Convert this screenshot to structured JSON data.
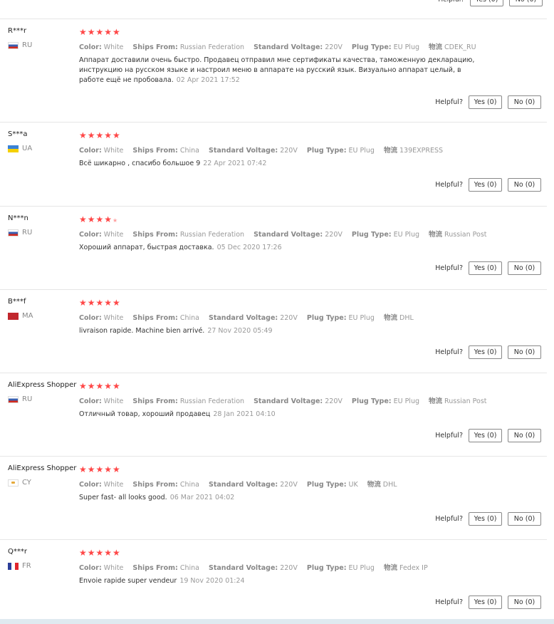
{
  "labels": {
    "helpful": "Helpful?",
    "yes": "Yes (0)",
    "no": "No (0)",
    "color": "Color:",
    "ships_from": "Ships From:",
    "standard_voltage": "Standard Voltage:",
    "plug_type": "Plug Type:",
    "logistics": "物流"
  },
  "colors": {
    "stars": "#ff4747",
    "button_border": "#888888",
    "bottom_bar": "#dfeaf0"
  },
  "reviews": [
    {
      "user": "R***r",
      "country": "RU",
      "rating": 5,
      "color": "White",
      "ships_from": "Russian Federation",
      "voltage": "220V",
      "plug": "EU Plug",
      "logistics": "CDEK_RU",
      "text": "Аппарат доставили очень быстро. Продавец отправил мне сертификаты качества, таможенную декларацию, инструкцию на русском языке и настроил меню в аппарате на русский язык. Визуально аппарат целый, в работе ещё не пробовала.",
      "date": "02 Apr 2021 17:52"
    },
    {
      "user": "S***a",
      "country": "UA",
      "rating": 5,
      "color": "White",
      "ships_from": "China",
      "voltage": "220V",
      "plug": "EU Plug",
      "logistics": "139EXPRESS",
      "text": "Всё шикарно , спасибо большое 9",
      "date": "22 Apr 2021 07:42"
    },
    {
      "user": "N***n",
      "country": "RU",
      "rating": 5,
      "color": "White",
      "ships_from": "Russian Federation",
      "voltage": "220V",
      "plug": "EU Plug",
      "logistics": "Russian Post",
      "text": "Хороший аппарат, быстрая доставка.",
      "date": "05 Dec 2020 17:26"
    },
    {
      "user": "B***f",
      "country": "MA",
      "rating": 5,
      "color": "White",
      "ships_from": "China",
      "voltage": "220V",
      "plug": "EU Plug",
      "logistics": "DHL",
      "text": "livraison rapide. Machine bien arrivé.",
      "date": "27 Nov 2020 05:49"
    },
    {
      "user": "AliExpress Shopper",
      "country": "RU",
      "rating": 5,
      "color": "White",
      "ships_from": "Russian Federation",
      "voltage": "220V",
      "plug": "EU Plug",
      "logistics": "Russian Post",
      "text": "Отличный товар, хороший продавец",
      "date": "28 Jan 2021 04:10"
    },
    {
      "user": "AliExpress Shopper",
      "country": "CY",
      "rating": 5,
      "color": "White",
      "ships_from": "China",
      "voltage": "220V",
      "plug": "UK",
      "logistics": "DHL",
      "text": "Super fast- all looks good.",
      "date": "06 Mar 2021 04:02"
    },
    {
      "user": "Q***r",
      "country": "FR",
      "rating": 5,
      "color": "White",
      "ships_from": "China",
      "voltage": "220V",
      "plug": "EU Plug",
      "logistics": "Fedex IP",
      "text": "Envoie rapide super vendeur",
      "date": "19 Nov 2020 01:24"
    }
  ]
}
